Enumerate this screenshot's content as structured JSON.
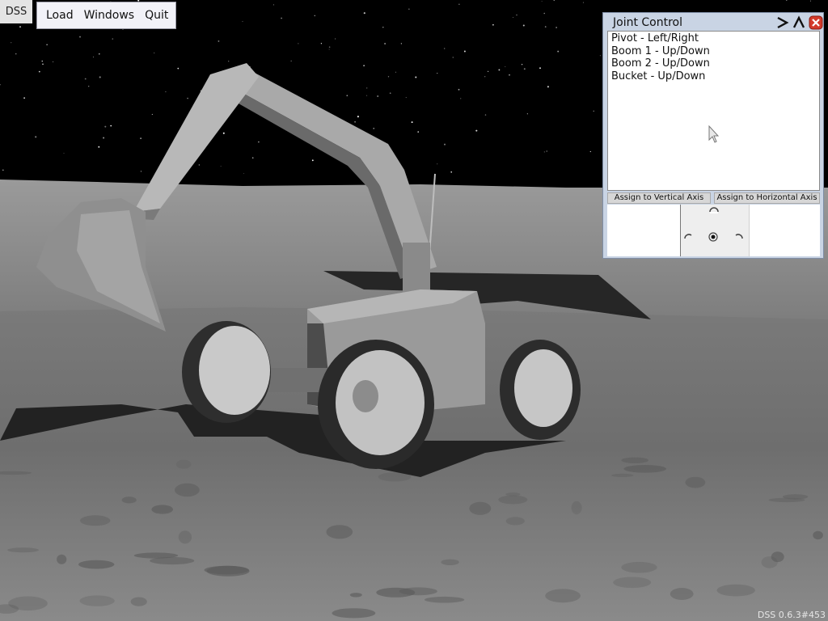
{
  "app": {
    "tag": "DSS",
    "version": "DSS 0.6.3#453"
  },
  "menubar": {
    "items": [
      "Load",
      "Windows",
      "Quit"
    ]
  },
  "joint_control": {
    "title": "Joint Control",
    "joints": [
      "Pivot - Left/Right",
      "Boom 1 - Up/Down",
      "Boom 2 - Up/Down",
      "Bucket - Up/Down"
    ],
    "assign_vertical": "Assign to Vertical Axis",
    "assign_horizontal": "Assign to Horizontal Axis"
  },
  "colors": {
    "close": "#d33a2a",
    "window_bg": "#c9d4e4",
    "sky": "#000000",
    "ground": "#7b7b7b"
  },
  "icons": [
    "expand-right-icon",
    "collapse-up-icon",
    "close-icon",
    "joystick-center-icon",
    "joystick-up-icon",
    "joystick-down-icon",
    "joystick-left-icon",
    "joystick-right-icon",
    "mouse-cursor-icon"
  ]
}
